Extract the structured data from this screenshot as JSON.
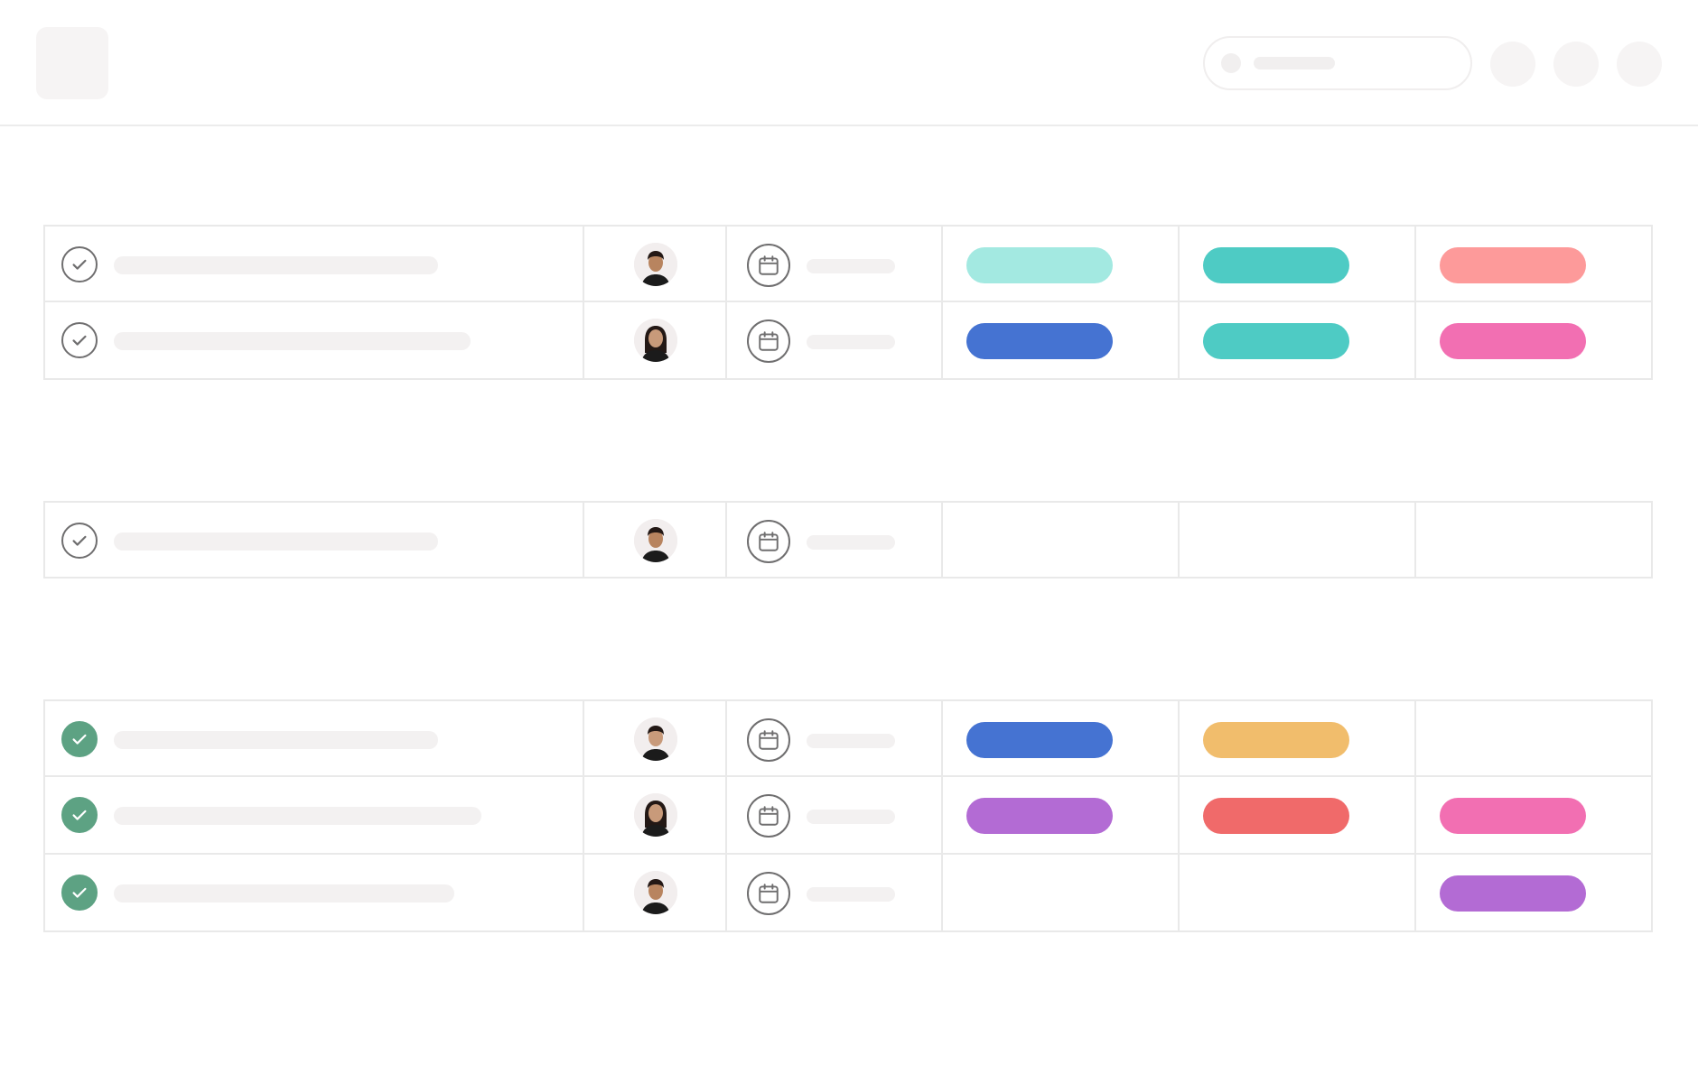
{
  "header": {
    "logo_icon": "logo-placeholder-icon",
    "search": {
      "placeholder": "",
      "icon": "search-dot-icon"
    },
    "buttons": [
      "action-button-1",
      "action-button-2",
      "action-button-3"
    ]
  },
  "colors": {
    "check_done": "#5da283",
    "check_outline": "#6f6e6f",
    "border": "#e9e9e9",
    "placeholder": "#f3f1f1",
    "tag_aqua": "#a3e9e1",
    "tag_teal": "#4ecbc4",
    "tag_coral": "#fd9a9a",
    "tag_blue": "#4573d2",
    "tag_pink": "#f26fb2",
    "tag_yellow": "#f1bd6c",
    "tag_purple": "#b36bd4",
    "tag_red": "#f06a6a"
  },
  "sections": [
    {
      "rows": [
        {
          "completed": false,
          "name_bar": 0.6,
          "assignee": "man-short-hair",
          "tags": [
            "#a3e9e1",
            "#4ecbc4",
            "#fd9a9a"
          ]
        },
        {
          "completed": false,
          "name_bar": 0.66,
          "assignee": "woman-long-hair",
          "tags": [
            "#4573d2",
            "#4ecbc4",
            "#f26fb2"
          ]
        }
      ]
    },
    {
      "rows": [
        {
          "completed": false,
          "name_bar": 0.6,
          "assignee": "man-smiling",
          "tags": [
            null,
            null,
            null
          ]
        }
      ]
    },
    {
      "rows": [
        {
          "completed": true,
          "name_bar": 0.6,
          "assignee": "woman-short-hair",
          "tags": [
            "#4573d2",
            "#f1bd6c",
            null
          ]
        },
        {
          "completed": true,
          "name_bar": 0.68,
          "assignee": "woman-long-hair-2",
          "tags": [
            "#b36bd4",
            "#f06a6a",
            "#f26fb2"
          ]
        },
        {
          "completed": true,
          "name_bar": 0.63,
          "assignee": "man-smiling-2",
          "tags": [
            null,
            null,
            "#b36bd4"
          ]
        }
      ]
    }
  ]
}
